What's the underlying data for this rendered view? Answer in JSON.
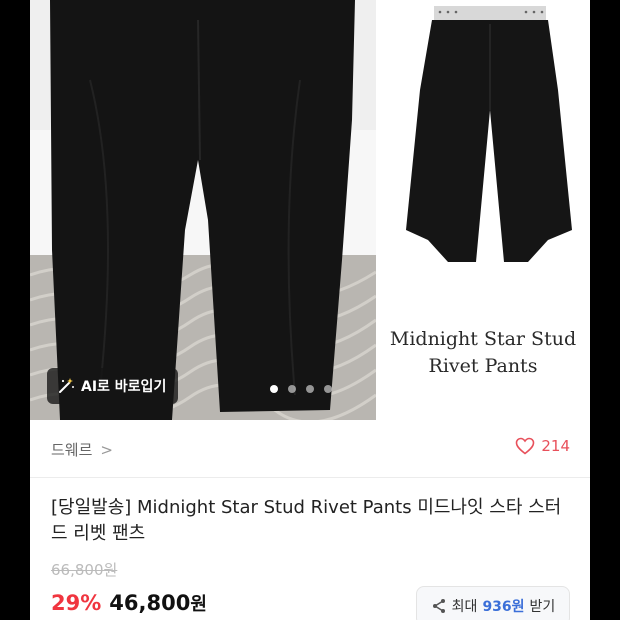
{
  "gallery": {
    "ai_button_label": "AI로 바로입기",
    "dots_total": 4,
    "dots_active_index": 0,
    "side_caption_line1": "Midnight Star Stud",
    "side_caption_line2": "Rivet Pants"
  },
  "store": {
    "name": "드웨르",
    "chevron": ">",
    "likes": "214"
  },
  "product": {
    "title": "[당일발송] Midnight Star Stud Rivet Pants 미드나잇 스타 스터드 리벳 팬츠",
    "original_price": "66,800원",
    "discount": "29%",
    "sale_price": "46,800",
    "currency": "원"
  },
  "points": {
    "prefix": "최대",
    "amount": "936원",
    "suffix": "받기"
  },
  "colors": {
    "discount": "#f0353f",
    "like": "#e8505b",
    "points": "#3b6fd8"
  }
}
